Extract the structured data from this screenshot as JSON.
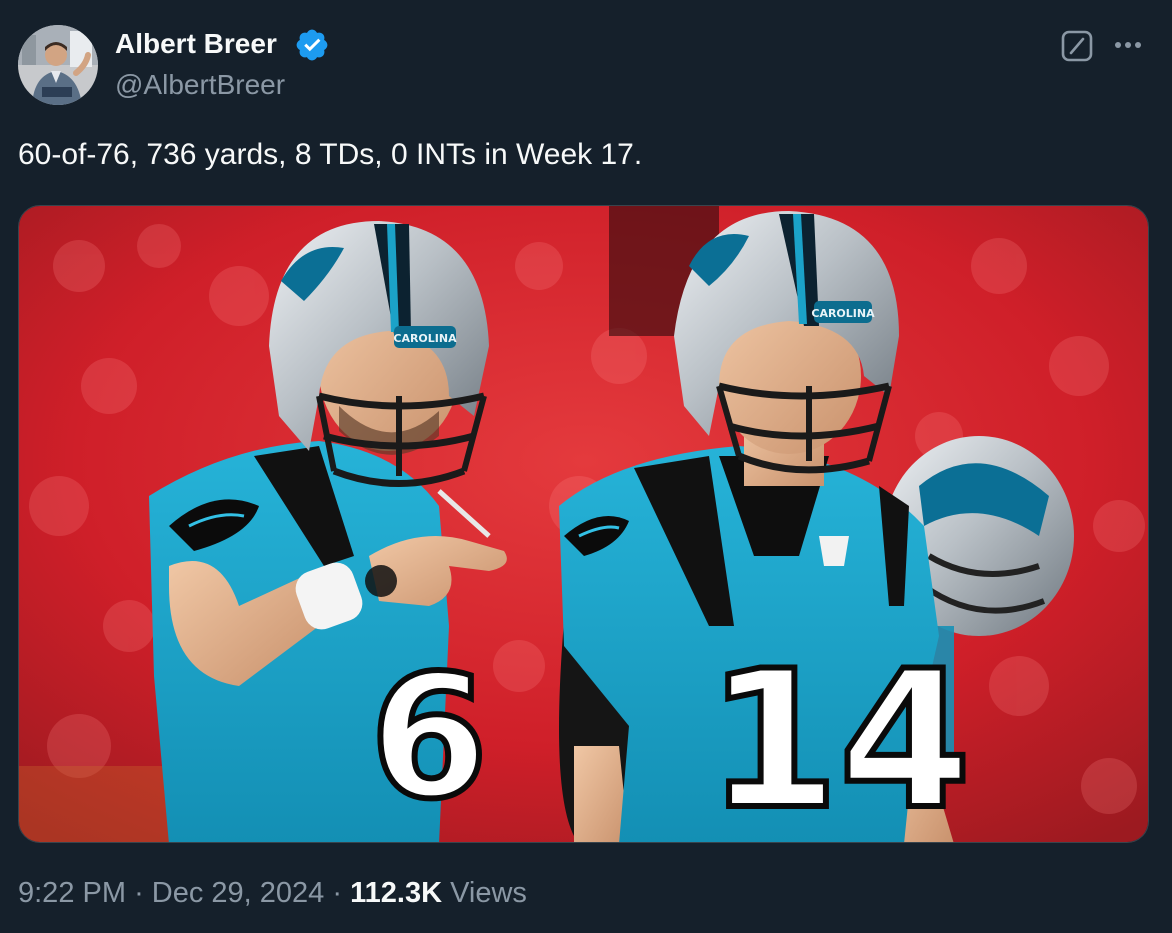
{
  "author": {
    "display_name": "Albert Breer",
    "handle": "@AlbertBreer",
    "verified": true
  },
  "tweet": {
    "text": "60-of-76, 736 yards, 8 TDs, 0 INTs in Week 17."
  },
  "media": {
    "left_player_number": "6",
    "right_player_number": "14",
    "left_helmet_text": "CAROLINA",
    "right_helmet_text": "CAROLINA"
  },
  "meta": {
    "time": "9:22 PM",
    "separator": "·",
    "date": "Dec 29, 2024",
    "views_count": "112.3K",
    "views_label": "Views"
  },
  "icons": {
    "grok": "grok-icon",
    "more": "more-horizontal-icon",
    "verified": "verified-badge-icon"
  },
  "colors": {
    "background": "#15202b",
    "text_primary": "#f7f9f9",
    "text_secondary": "#8b98a5",
    "verified_blue": "#1d9bf0",
    "panthers_blue": "#1ba2c8",
    "stadium_red": "#d8222c"
  }
}
